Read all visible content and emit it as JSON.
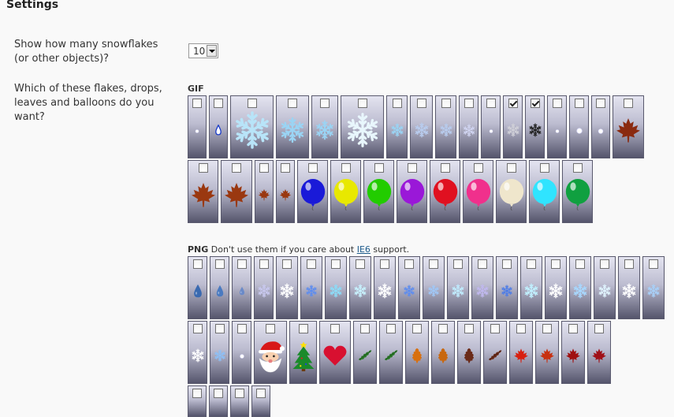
{
  "heading": "Settings",
  "count_question": "Show how many snowflakes (or other objects)?",
  "count_value": "10",
  "flakes_question": "Which of these flakes, drops, leaves and balloons do you want?",
  "gif_label": "GIF",
  "png_label": "PNG",
  "png_note_before": " Don't use them if you care about ",
  "png_note_link": "IE6",
  "png_note_after": " support.",
  "colors": {
    "tile_top": "#e4e4f0",
    "tile_bottom": "#55556c",
    "link": "#1e5b8c"
  },
  "gif_row1": [
    {
      "icon": "dot-icon",
      "checked": false
    },
    {
      "icon": "blue-drop-icon",
      "checked": false
    },
    {
      "icon": "snowflake-icon",
      "checked": false
    },
    {
      "icon": "snowflake-icon",
      "checked": false
    },
    {
      "icon": "snowflake-icon",
      "checked": false
    },
    {
      "icon": "snowflake-icon",
      "checked": false
    },
    {
      "icon": "snowflake-icon",
      "checked": false
    },
    {
      "icon": "snowflake-icon",
      "checked": false
    },
    {
      "icon": "snowflake-icon",
      "checked": false
    },
    {
      "icon": "snowflake-icon",
      "checked": false
    },
    {
      "icon": "dot-icon",
      "checked": false
    },
    {
      "icon": "snowflake-icon",
      "checked": true
    },
    {
      "icon": "snowflake-icon",
      "checked": true
    },
    {
      "icon": "dot-icon",
      "checked": false
    },
    {
      "icon": "dot-icon",
      "checked": false
    },
    {
      "icon": "dot-icon",
      "checked": false
    },
    {
      "icon": "maple-leaf-icon",
      "checked": false
    }
  ],
  "gif_row2": [
    {
      "icon": "maple-leaf-icon",
      "checked": false
    },
    {
      "icon": "maple-leaf-icon",
      "checked": false
    },
    {
      "icon": "maple-leaf-icon",
      "checked": false
    },
    {
      "icon": "maple-leaf-icon",
      "checked": false
    },
    {
      "icon": "balloon-icon",
      "color": "#1a1ad8",
      "checked": false
    },
    {
      "icon": "balloon-icon",
      "color": "#e8e800",
      "checked": false
    },
    {
      "icon": "balloon-icon",
      "color": "#22cc00",
      "checked": false
    },
    {
      "icon": "balloon-icon",
      "color": "#9a18d8",
      "checked": false
    },
    {
      "icon": "balloon-icon",
      "color": "#e01020",
      "checked": false
    },
    {
      "icon": "balloon-icon",
      "color": "#f0308c",
      "checked": false
    },
    {
      "icon": "balloon-icon",
      "color": "#efe6cc",
      "checked": false
    },
    {
      "icon": "balloon-icon",
      "color": "#30e4ff",
      "checked": false
    },
    {
      "icon": "balloon-icon",
      "color": "#10a040",
      "checked": false
    }
  ],
  "png_row1": [
    {
      "icon": "water-drop-icon",
      "checked": false
    },
    {
      "icon": "water-drop-icon",
      "checked": false
    },
    {
      "icon": "water-drop-icon",
      "checked": false
    },
    {
      "icon": "snowflake-icon",
      "checked": false
    },
    {
      "icon": "snowflake-icon",
      "checked": false
    },
    {
      "icon": "snowflake-icon",
      "checked": false
    },
    {
      "icon": "snowflake-icon",
      "checked": false
    },
    {
      "icon": "snowflake-icon",
      "checked": false
    },
    {
      "icon": "snowflake-icon",
      "checked": false
    },
    {
      "icon": "snowflake-icon",
      "checked": false
    },
    {
      "icon": "snowflake-icon",
      "checked": false
    },
    {
      "icon": "snowflake-icon",
      "checked": false
    },
    {
      "icon": "snowflake-icon",
      "checked": false
    },
    {
      "icon": "snowflake-icon",
      "checked": false
    },
    {
      "icon": "snowflake-icon",
      "checked": false
    },
    {
      "icon": "snowflake-icon",
      "checked": false
    },
    {
      "icon": "snowflake-icon",
      "checked": false
    },
    {
      "icon": "snowflake-icon",
      "checked": false
    },
    {
      "icon": "snowflake-icon",
      "checked": false
    },
    {
      "icon": "snowflake-icon",
      "checked": false
    }
  ],
  "png_row2": [
    {
      "icon": "snowflake-icon",
      "checked": false
    },
    {
      "icon": "snowflake-icon",
      "checked": false
    },
    {
      "icon": "dot-icon",
      "checked": false
    },
    {
      "icon": "santa-icon",
      "checked": false
    },
    {
      "icon": "christmas-tree-icon",
      "checked": false
    },
    {
      "icon": "heart-icon",
      "checked": false
    },
    {
      "icon": "holly-leaf-icon",
      "checked": false
    },
    {
      "icon": "holly-leaf-icon",
      "checked": false
    },
    {
      "icon": "oak-leaf-icon",
      "checked": false
    },
    {
      "icon": "oak-leaf-icon",
      "checked": false
    },
    {
      "icon": "oak-leaf-icon",
      "checked": false
    },
    {
      "icon": "holly-leaf-icon",
      "checked": false
    },
    {
      "icon": "maple-leaf-icon",
      "checked": false
    },
    {
      "icon": "maple-leaf-icon",
      "checked": false
    },
    {
      "icon": "maple-leaf-icon",
      "checked": false
    },
    {
      "icon": "maple-leaf-icon",
      "checked": false
    }
  ],
  "png_row3": [
    {
      "icon": "",
      "checked": false
    },
    {
      "icon": "",
      "checked": false
    },
    {
      "icon": "",
      "checked": false
    },
    {
      "icon": "",
      "checked": false
    }
  ]
}
